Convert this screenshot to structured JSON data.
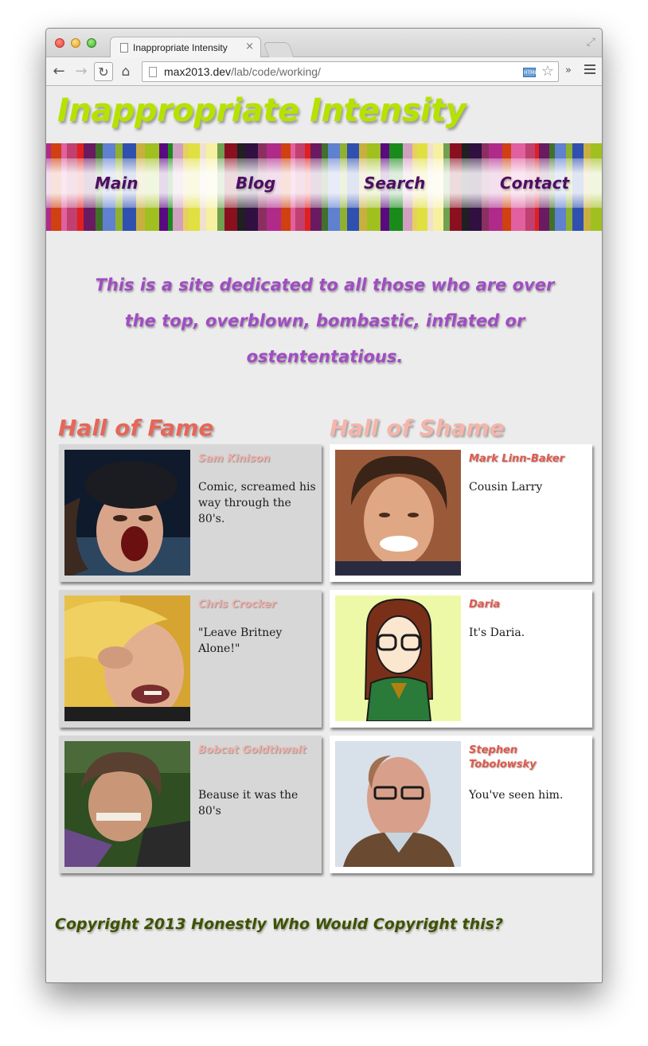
{
  "browser": {
    "tab_title": "Inappropriate Intensity",
    "tab_close": "×",
    "url_host": "max2013.dev",
    "url_path": "/lab/code/working/",
    "html_badge": "HTML",
    "icons": [
      "back-arrow-icon",
      "forward-arrow-icon",
      "reload-icon",
      "home-icon",
      "page-icon",
      "star-icon",
      "chevron-more-icon",
      "menu-icon",
      "fullscreen-icon"
    ]
  },
  "site": {
    "title": "Inappropriate Intensity",
    "title_color": "#b6e200",
    "nav": [
      "Main",
      "Blog",
      "Search",
      "Contact"
    ],
    "intro": "This is a site dedicated to all those who are over the top, overblown, bombastic, inflated or ostententatious."
  },
  "hall_of_fame": {
    "heading": "Hall of Fame",
    "entries": [
      {
        "name": "Sam Kinison",
        "desc": "Comic, screamed his way through the 80's."
      },
      {
        "name": "Chris Crocker",
        "desc": "\"Leave Britney Alone!\""
      },
      {
        "name": "Bobcat Goldthwait",
        "desc": "Beause it was the 80's"
      }
    ]
  },
  "hall_of_shame": {
    "heading": "Hall of Shame",
    "entries": [
      {
        "name": "Mark Linn-Baker",
        "desc": "Cousin Larry"
      },
      {
        "name": "Daria",
        "desc": "It's Daria."
      },
      {
        "name": "Stephen Tobolowsky",
        "desc": "You've seen him."
      }
    ]
  },
  "footer": {
    "text": "Copyright 2013 Honestly Who Would Copyright this?"
  },
  "colors": {
    "nav_link": "#4e0e62",
    "intro": "#a04dc2",
    "fame_heading": "#e56758",
    "shame_heading": "#f4b5ab",
    "footer": "#3d5200"
  }
}
